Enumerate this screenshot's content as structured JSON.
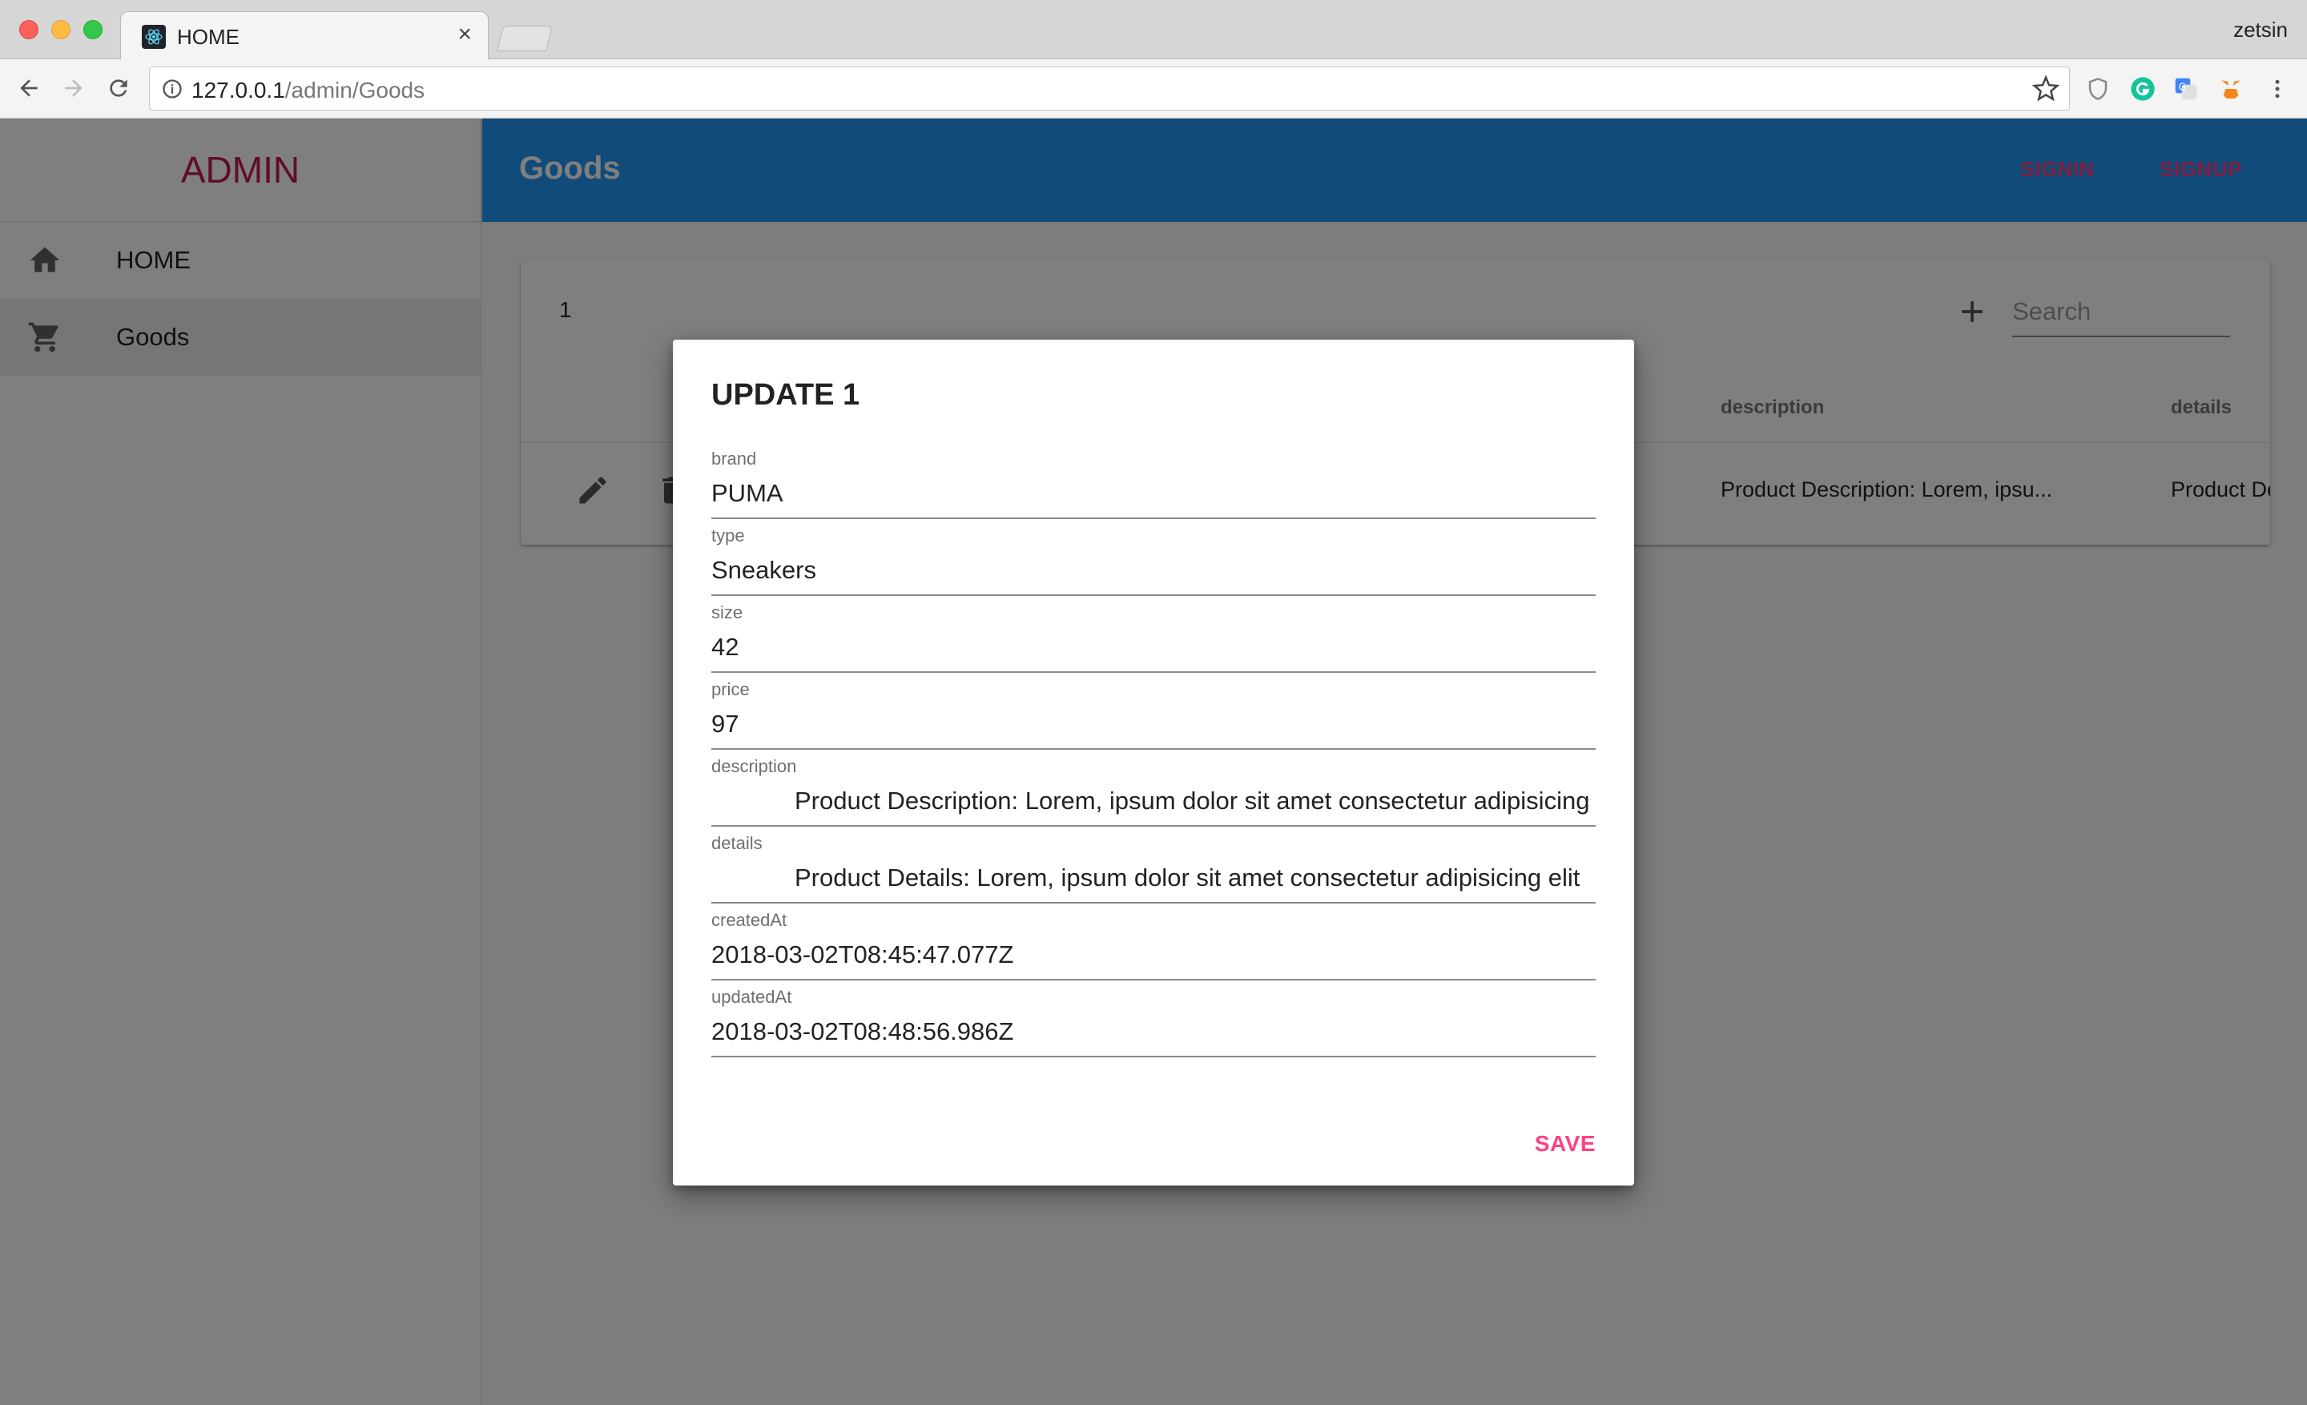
{
  "browser": {
    "tab_title": "HOME",
    "close_glyph": "×",
    "os_user": "zetsin",
    "url_host": "127.0.0.1",
    "url_path": "/admin/Goods"
  },
  "sidebar": {
    "brand": "ADMIN",
    "items": [
      {
        "label": "HOME",
        "icon": "home-icon",
        "selected": false
      },
      {
        "label": "Goods",
        "icon": "cart-icon",
        "selected": true
      }
    ]
  },
  "appbar": {
    "title": "Goods",
    "signin_label": "SIGNIN",
    "signup_label": "SIGNUP"
  },
  "table": {
    "title": "1",
    "search_placeholder": "Search",
    "columns": {
      "description": "description",
      "details": "details"
    },
    "row": {
      "description": "Product Description: Lorem, ipsu...",
      "details": "Product De"
    }
  },
  "dialog": {
    "title": "UPDATE 1",
    "save_label": "SAVE",
    "fields": [
      {
        "label": "brand",
        "value": "PUMA"
      },
      {
        "label": "type",
        "value": "Sneakers"
      },
      {
        "label": "size",
        "value": "42"
      },
      {
        "label": "price",
        "value": "97"
      },
      {
        "label": "description",
        "value": "Product Description: Lorem, ipsum dolor sit amet consectetur adipisicing"
      },
      {
        "label": "details",
        "value": "Product Details: Lorem, ipsum dolor sit amet consectetur adipisicing elit"
      },
      {
        "label": "createdAt",
        "value": "2018-03-02T08:45:47.077Z"
      },
      {
        "label": "updatedAt",
        "value": "2018-03-02T08:48:56.986Z"
      }
    ]
  },
  "colors": {
    "appbar": "#2196f3",
    "accent": "#ff4081",
    "brand": "#c2185b"
  }
}
